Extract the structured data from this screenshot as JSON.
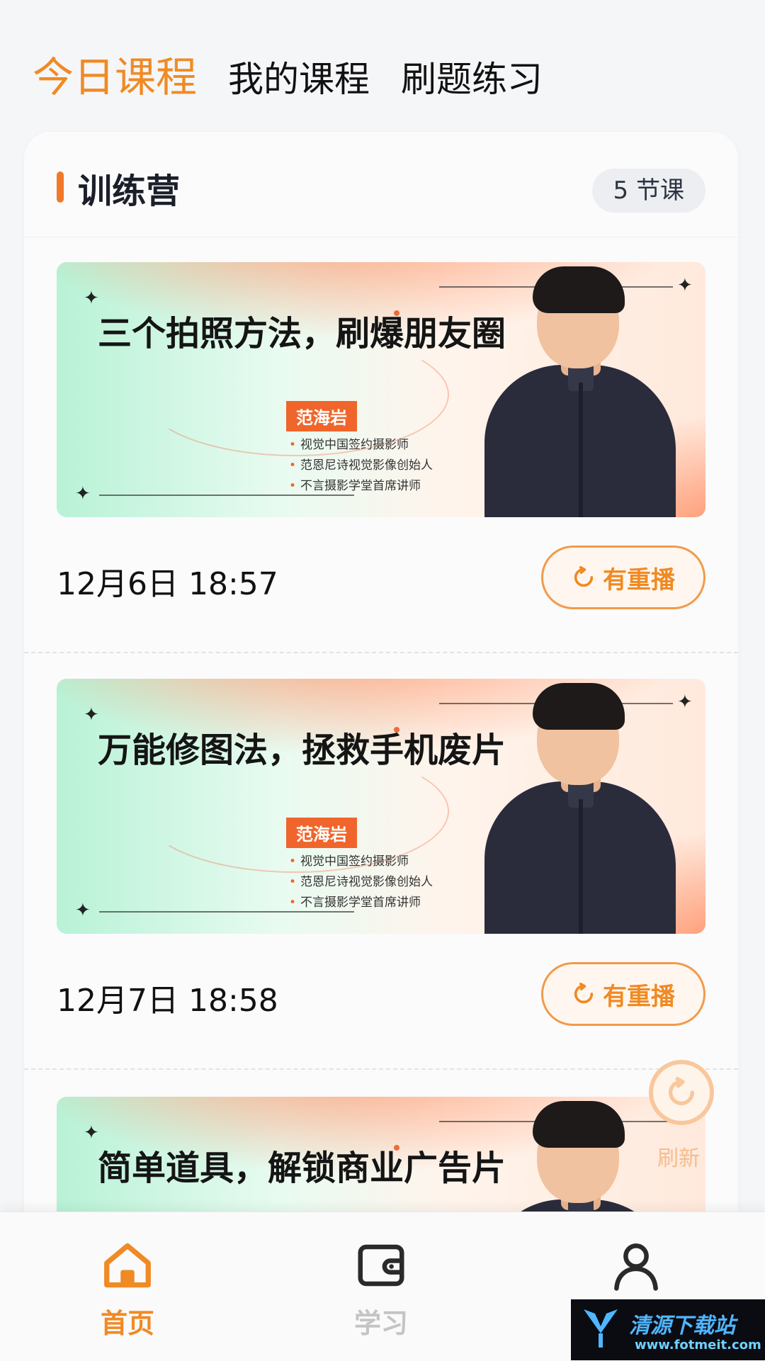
{
  "top_tabs": [
    {
      "label": "今日课程",
      "active": true
    },
    {
      "label": "我的课程",
      "active": false
    },
    {
      "label": "刷题练习",
      "active": false
    }
  ],
  "section": {
    "title": "训练营",
    "count": "5 节课"
  },
  "lessons": [
    {
      "banner_title": "三个拍照方法，刷爆朋友圈",
      "instructor": "范海岩",
      "bullets": [
        "视觉中国签约摄影师",
        "范恩尼诗视觉影像创始人",
        "不言摄影学堂首席讲师"
      ],
      "date": "12月6日 18:57",
      "action": "有重播"
    },
    {
      "banner_title": "万能修图法，拯救手机废片",
      "instructor": "范海岩",
      "bullets": [
        "视觉中国签约摄影师",
        "范恩尼诗视觉影像创始人",
        "不言摄影学堂首席讲师"
      ],
      "date": "12月7日 18:58",
      "action": "有重播"
    },
    {
      "banner_title": "简单道具，解锁商业广告片"
    }
  ],
  "refresh": {
    "label": "刷新"
  },
  "bottom_nav": [
    {
      "label": "首页",
      "icon": "home-icon",
      "active": true
    },
    {
      "label": "学习",
      "icon": "wallet-icon",
      "active": false
    },
    {
      "label": "",
      "icon": "user-icon",
      "active": false
    }
  ],
  "watermark": {
    "main": "清源下载站",
    "url": "www.fotmeit.com"
  },
  "colors": {
    "accent": "#f08a24",
    "banner_orange": "#f0652b",
    "mint": "#b8f2d6"
  }
}
